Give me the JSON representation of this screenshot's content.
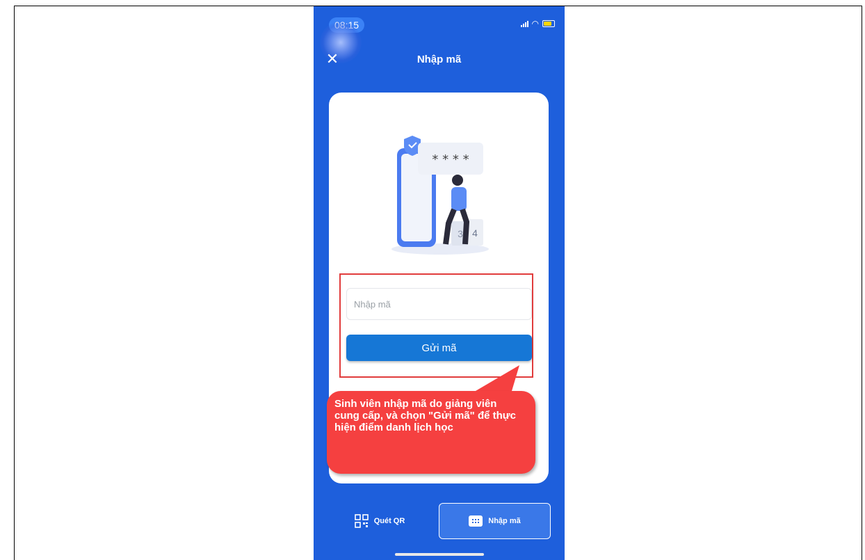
{
  "status_bar": {
    "time": "08:15"
  },
  "header": {
    "title": "Nhập mã"
  },
  "illustration": {
    "code_mask": "* * * *",
    "block_3": "3",
    "block_4": "4"
  },
  "form": {
    "input_placeholder": "Nhập mã",
    "input_value": "",
    "submit_label": "Gửi mã"
  },
  "callout": {
    "text": "Sinh viên nhập mã do giảng viên cung cấp, và chọn \"Gửi mã\" để thực hiện điểm danh lịch học"
  },
  "bottom_tabs": [
    {
      "label": "Quét QR",
      "icon": "qr-code-icon",
      "active": false
    },
    {
      "label": "Nhập mã",
      "icon": "keyboard-icon",
      "active": true
    }
  ],
  "colors": {
    "primary": "#1e5fdc",
    "button": "#1677d6",
    "callout": "#f54040",
    "highlight": "#e13c3c"
  }
}
